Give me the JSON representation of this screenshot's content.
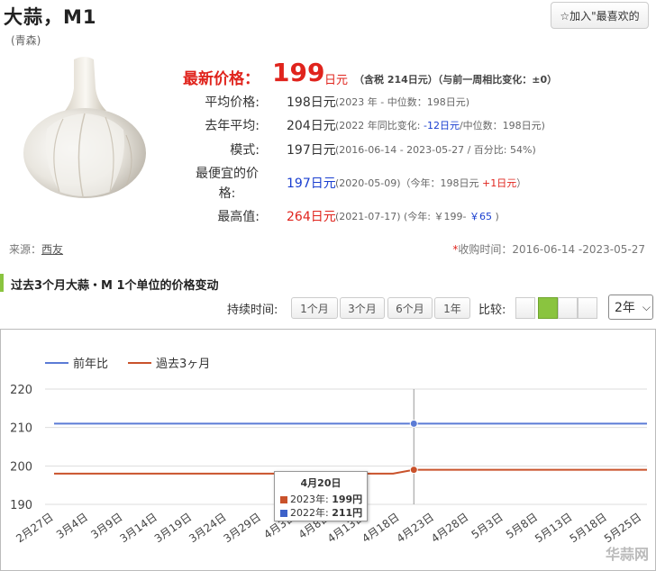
{
  "header": {
    "title": "大蒜，M1",
    "subtitle": "(青森)",
    "favorite_label": "☆加入\"最喜欢的"
  },
  "prices": {
    "latest_label": "最新价格：",
    "latest_value": "199",
    "latest_unit": "日元",
    "latest_note": "（含税 214日元）（与前一周相比变化：±0）",
    "rows": [
      {
        "label": "平均价格:",
        "value": "198日元",
        "note": "(2023 年 - 中位数：198日元)"
      },
      {
        "label": "去年平均:",
        "value": "204日元",
        "note_pre": "(2022 年同比变化: ",
        "note_hl": "-12日元",
        "note_post": "/中位数：198日元)"
      },
      {
        "label": "模式:",
        "value": "197日元",
        "note": "(2016-06-14 - 2023-05-27 / 百分比: 54%)"
      },
      {
        "label": "最便宜的价格:",
        "value": "197日元",
        "note_pre": "(2020-05-09)（今年：198日元 ",
        "note_hl": "+1日元",
        "note_post": "）"
      },
      {
        "label": "最高值:",
        "value": "264日元",
        "note_pre": "(2021-07-17) (今年: ￥199- ",
        "note_hl": "￥65",
        "note_post": " )"
      }
    ]
  },
  "source": {
    "label": "来源：",
    "link": "西友"
  },
  "period": {
    "star": "*",
    "text": "收购时间：2016-06-14 -2023-05-27"
  },
  "section_title": "过去3个月大蒜・M 1个单位的价格变动",
  "controls": {
    "duration_label": "持续时间:",
    "duration_buttons": [
      "1个月",
      "3个月",
      "6个月",
      "1年"
    ],
    "compare_label": "比较:",
    "year_select": "2年"
  },
  "chart_data": {
    "type": "line",
    "legend_placement": "top-left",
    "ylim": [
      190,
      220
    ],
    "yticks": [
      190,
      200,
      210,
      220
    ],
    "grid": true,
    "x_ticks": [
      "2月27日",
      "3月4日",
      "3月9日",
      "3月14日",
      "3月19日",
      "3月24日",
      "3月29日",
      "4月3日",
      "4月8日",
      "4月13日",
      "4月18日",
      "4月23日",
      "4月28日",
      "5月3日",
      "5月8日",
      "5月13日",
      "5月18日",
      "5月25日"
    ],
    "series": [
      {
        "name": "前年比",
        "color": "#5b7bd5",
        "points": [
          [
            "2月27日",
            211
          ],
          [
            "4月20日",
            211
          ],
          [
            "5月27日",
            211
          ]
        ]
      },
      {
        "name": "過去3ヶ月",
        "color": "#c9522b",
        "points": [
          [
            "2月27日",
            198
          ],
          [
            "4月17日",
            198
          ],
          [
            "4月20日",
            199
          ],
          [
            "5月27日",
            199
          ]
        ]
      }
    ],
    "tooltip": {
      "date": "4月20日",
      "rows": [
        {
          "label": "2023年: ",
          "value": "199円",
          "color": "#c9522b"
        },
        {
          "label": "2022年: ",
          "value": "211円",
          "color": "#3d62c9"
        }
      ]
    }
  },
  "watermark": "华蒜网"
}
